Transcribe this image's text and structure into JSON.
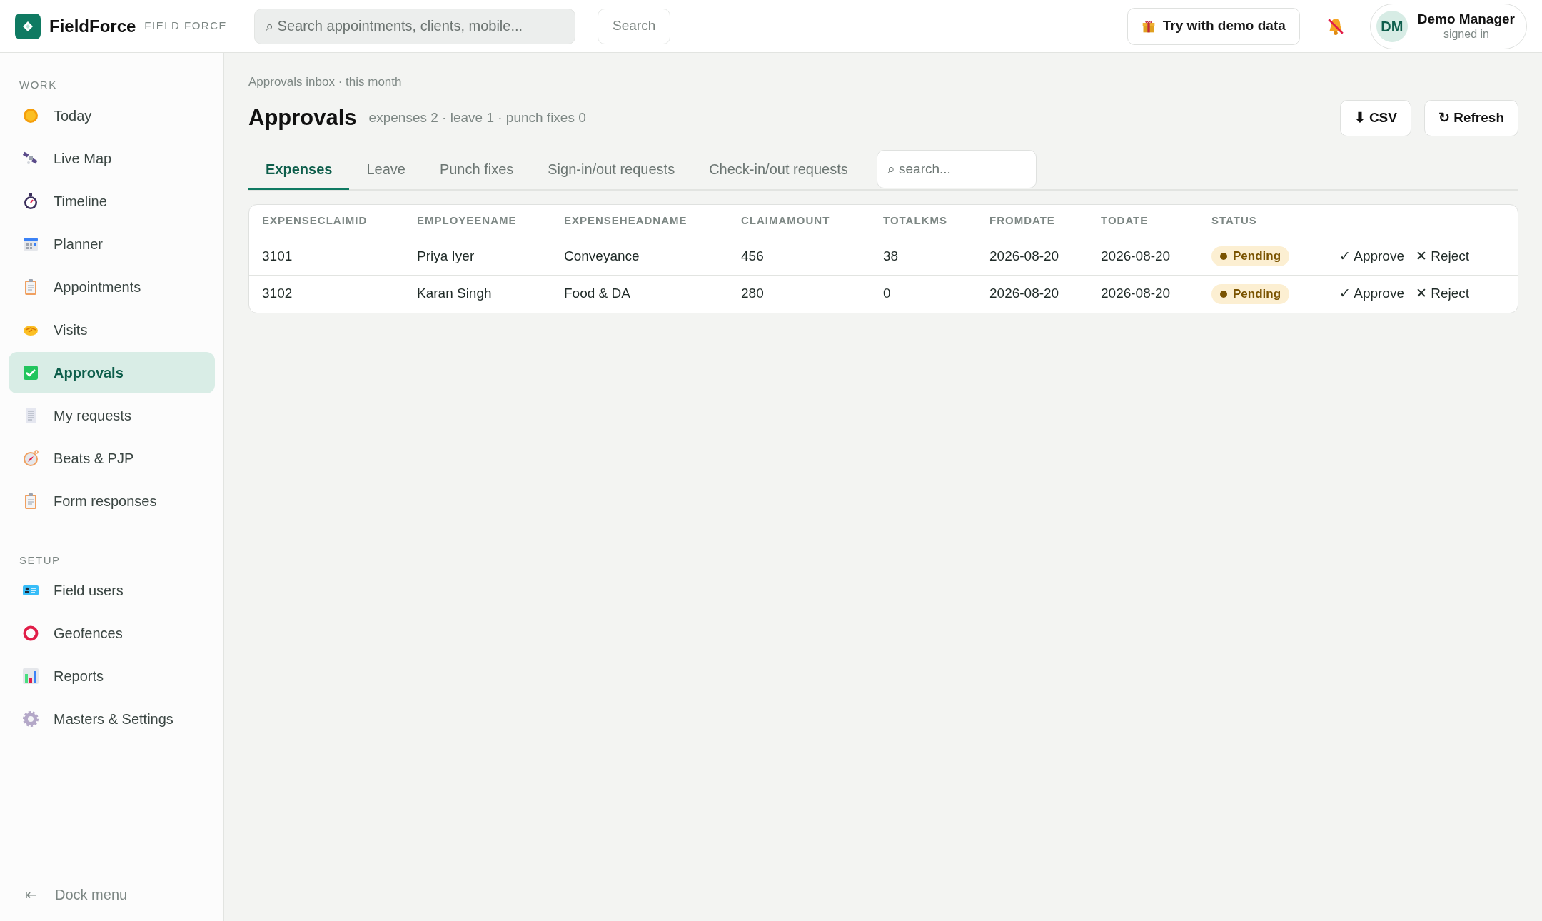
{
  "app": {
    "name": "FieldForce",
    "tagline": "FIELD FORCE"
  },
  "search": {
    "placeholder": "⌕ Search appointments, clients, mobile...",
    "button": "Search"
  },
  "demo_button": "Try with demo data",
  "notifications": {
    "muted": true
  },
  "user": {
    "initials": "DM",
    "name": "Demo Manager",
    "status": "signed in"
  },
  "sidebar": {
    "sections": [
      {
        "title": "WORK",
        "items": [
          {
            "label": "Today",
            "selected": false
          },
          {
            "label": "Live Map",
            "selected": false
          },
          {
            "label": "Timeline",
            "selected": false
          },
          {
            "label": "Planner",
            "selected": false
          },
          {
            "label": "Appointments",
            "selected": false
          },
          {
            "label": "Visits",
            "selected": false
          },
          {
            "label": "Approvals",
            "selected": true
          },
          {
            "label": "My requests",
            "selected": false
          },
          {
            "label": "Beats & PJP",
            "selected": false
          },
          {
            "label": "Form responses",
            "selected": false
          }
        ]
      },
      {
        "title": "SETUP",
        "items": [
          {
            "label": "Field users",
            "selected": false
          },
          {
            "label": "Geofences",
            "selected": false
          },
          {
            "label": "Reports",
            "selected": false
          },
          {
            "label": "Masters & Settings",
            "selected": false
          }
        ]
      }
    ],
    "dock": {
      "glyph": "⇤",
      "label": "Dock menu"
    }
  },
  "page": {
    "breadcrumb": "Approvals inbox · this month",
    "title": "Approvals",
    "summary": "expenses 2 · leave 1 · punch fixes 0",
    "actions": [
      {
        "glyph": "⬇",
        "label": "CSV"
      },
      {
        "glyph": "↻",
        "label": "Refresh"
      }
    ]
  },
  "tabs": [
    {
      "label": "Expenses",
      "selected": true
    },
    {
      "label": "Leave",
      "selected": false
    },
    {
      "label": "Punch fixes",
      "selected": false
    },
    {
      "label": "Sign-in/out requests",
      "selected": false
    },
    {
      "label": "Check-in/out requests",
      "selected": false
    }
  ],
  "filter": {
    "placeholder": "⌕ search..."
  },
  "table": {
    "columns": [
      "EXPENSECLAIMID",
      "EMPLOYEENAME",
      "EXPENSEHEADNAME",
      "CLAIMAMOUNT",
      "TOTALKMS",
      "FROMDATE",
      "TODATE",
      "STATUS"
    ],
    "rows": [
      {
        "cells": [
          "3101",
          "Priya Iyer",
          "Conveyance",
          "456",
          "38",
          "2026-08-20",
          "2026-08-20"
        ],
        "status": "Pending",
        "approve": "✓ Approve",
        "reject": "✕ Reject"
      },
      {
        "cells": [
          "3102",
          "Karan Singh",
          "Food & DA",
          "280",
          "0",
          "2026-08-20",
          "2026-08-20"
        ],
        "status": "Pending",
        "approve": "✓ Approve",
        "reject": "✕ Reject"
      }
    ]
  }
}
